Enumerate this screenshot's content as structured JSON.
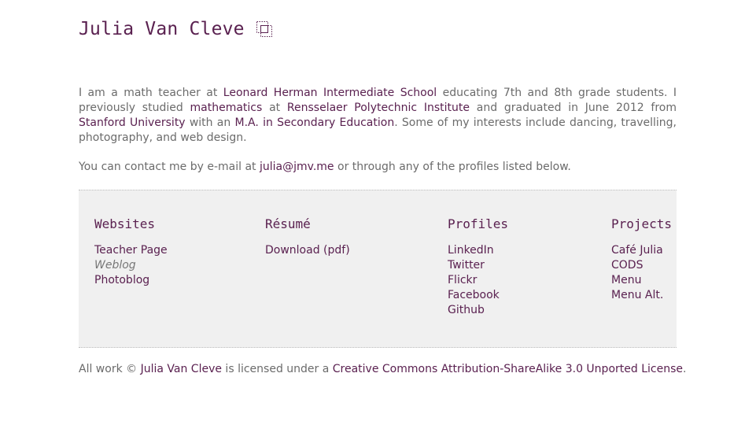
{
  "header": {
    "title": "Julia Van Cleve",
    "icon": "dotted-squares-icon"
  },
  "intro": {
    "t1": "I am a math teacher at ",
    "school_link": "Leonard Herman Intermediate School",
    "t2": " educating 7th and 8th grade students. I previously studied ",
    "math_link": "mathematics",
    "t3": " at ",
    "rpi_link": "Rensselaer Polytechnic Institute",
    "t4": " and graduated in June 2012 from ",
    "stanford_link": "Stanford University",
    "t5": " with an ",
    "ma_link": "M.A. in Secondary Education",
    "t6": ". Some of my interests include dancing, travelling, photography, and web design."
  },
  "contact": {
    "t1": "You can contact me by e-mail at ",
    "email_link": "julia@jmv.me",
    "t2": " or through any of the profiles listed below."
  },
  "sections": {
    "websites": {
      "heading": "Websites",
      "items": [
        "Teacher Page",
        "Weblog",
        "Photoblog"
      ]
    },
    "resume": {
      "heading": "Résumé",
      "items": [
        "Download (pdf)"
      ]
    },
    "profiles": {
      "heading": "Profiles",
      "items": [
        "LinkedIn",
        "Twitter",
        "Flickr",
        "Facebook",
        "Github"
      ]
    },
    "projects": {
      "heading": "Projects",
      "items": [
        "Café Julia",
        "CODS",
        "Menu",
        "Menu Alt."
      ]
    }
  },
  "footer": {
    "t1": "All work © ",
    "author_link": "Julia Van Cleve",
    "t2": " is licensed under a ",
    "license_link": "Creative Commons Attribution-ShareAlike 3.0 Unported License",
    "t3": "."
  },
  "colors": {
    "accent": "#5a2150",
    "text": "#6b6b6b",
    "panel_bg": "#f0f0f0"
  }
}
